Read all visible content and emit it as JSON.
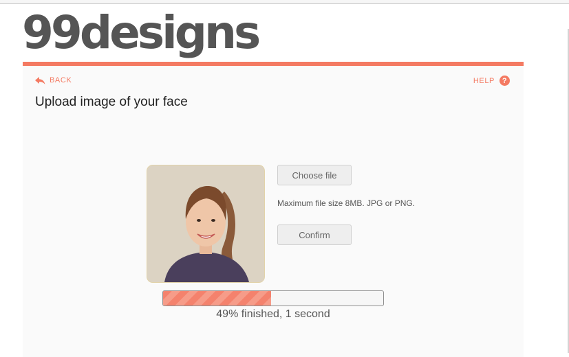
{
  "logo": {
    "text": "99designs"
  },
  "nav": {
    "back_label": "BACK",
    "help_label": "HELP",
    "help_symbol": "?"
  },
  "page": {
    "title": "Upload image of your face"
  },
  "upload": {
    "choose_label": "Choose file",
    "file_note": "Maximum file size 8MB. JPG or PNG.",
    "confirm_label": "Confirm"
  },
  "progress": {
    "percent": 49,
    "status_text": "49% finished, 1 second"
  },
  "colors": {
    "accent": "#f47a62",
    "logo": "#555555",
    "panel_bg": "#fafafa"
  },
  "icons": {
    "back": "reply-arrow-icon",
    "help": "question-circle-icon"
  }
}
